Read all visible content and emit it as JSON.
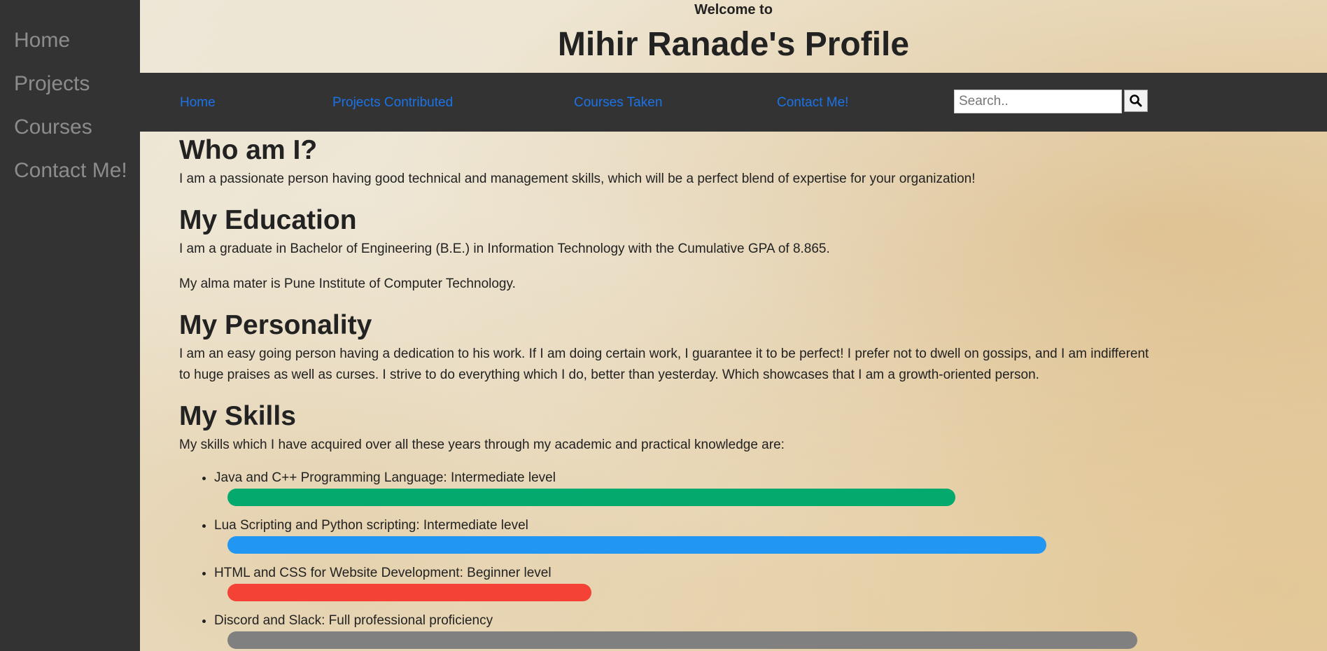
{
  "sidebar": {
    "items": [
      {
        "label": "Home"
      },
      {
        "label": "Projects"
      },
      {
        "label": "Courses"
      },
      {
        "label": "Contact Me!"
      }
    ]
  },
  "header": {
    "welcome": "Welcome to",
    "title": "Mihir Ranade's Profile"
  },
  "nav": {
    "items": [
      {
        "label": "Home"
      },
      {
        "label": "Projects Contributed"
      },
      {
        "label": "Courses Taken"
      },
      {
        "label": "Contact Me!"
      }
    ],
    "search_placeholder": "Search..",
    "search_icon": "search-icon"
  },
  "sections": {
    "who": {
      "heading": "Who am I?",
      "text": "I am a passionate person having good technical and management skills, which will be a perfect blend of expertise for your organization!"
    },
    "education": {
      "heading": "My Education",
      "text1": "I am a graduate in Bachelor of Engineering (B.E.) in Information Technology with the Cumulative GPA of 8.865.",
      "text2": "My alma mater is Pune Institute of Computer Technology."
    },
    "personality": {
      "heading": "My Personality",
      "text": "I am an easy going person having a dedication to his work. If I am doing certain work, I guarantee it to be perfect! I prefer not to dwell on gossips, and I am indifferent to huge praises as well as curses. I strive to do everything which I do, better than yesterday. Which showcases that I am a growth-oriented person."
    },
    "skills": {
      "heading": "My Skills",
      "intro": "My skills which I have acquired over all these years through my academic and practical knowledge are:",
      "items": [
        {
          "label": "Java and C++ Programming Language: Intermediate level",
          "level": 0.8,
          "color": "#04aa6d"
        },
        {
          "label": "Lua Scripting and Python scripting: Intermediate level",
          "level": 0.9,
          "color": "#2196f3"
        },
        {
          "label": "HTML and CSS for Website Development: Beginner level",
          "level": 0.4,
          "color": "#f44336"
        },
        {
          "label": "Discord and Slack: Full professional proficiency",
          "level": 1.0,
          "color": "#808080"
        }
      ]
    }
  }
}
